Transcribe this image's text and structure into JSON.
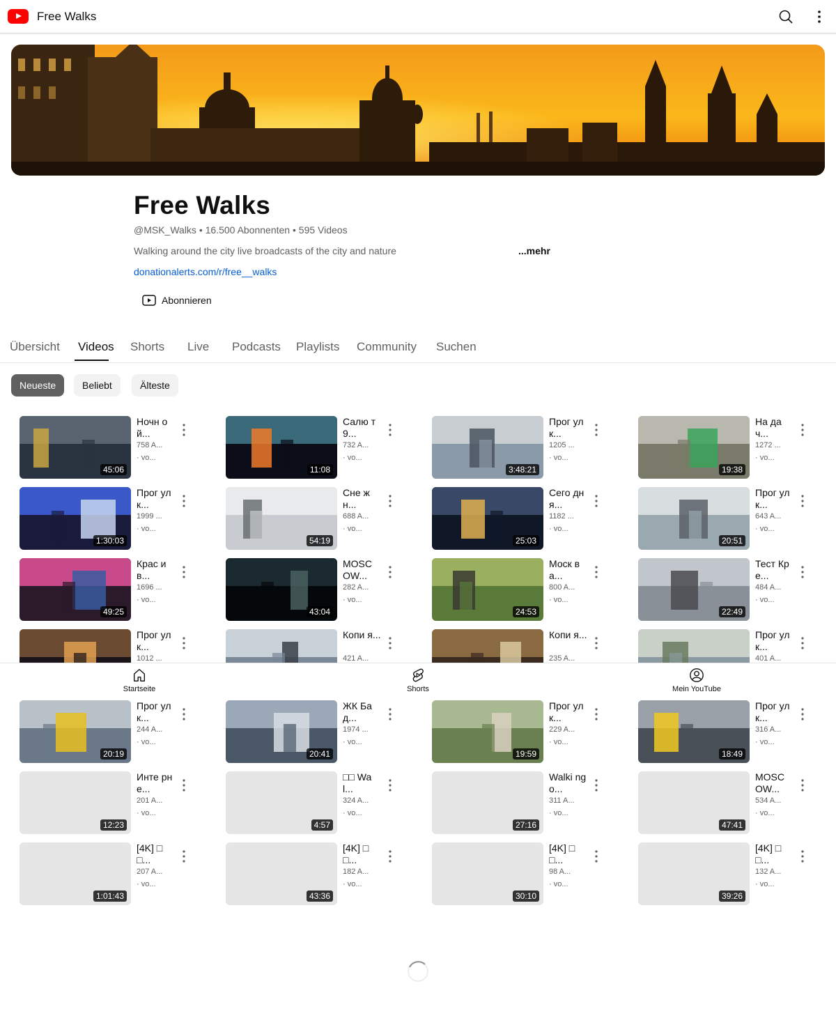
{
  "topbar": {
    "title": "Free Walks"
  },
  "channel": {
    "name": "Free Walks",
    "handle": "@MSK_Walks",
    "sep1": "•",
    "subscribers": "16.500 Abonnenten",
    "sep2": "•",
    "video_count": "595 Videos",
    "description": "Walking around the city live broadcasts of the city and nature",
    "more": "...mehr",
    "link": "donationalerts.com/r/free__walks",
    "subscribe_label": "Abonnieren"
  },
  "tabs": [
    {
      "label": "Übersicht"
    },
    {
      "label": "Videos"
    },
    {
      "label": "Shorts"
    },
    {
      "label": "Live"
    },
    {
      "label": "Podcasts"
    },
    {
      "label": "Playlists"
    },
    {
      "label": "Community"
    },
    {
      "label": "Suchen"
    }
  ],
  "chips": [
    {
      "label": "Neueste"
    },
    {
      "label": "Beliebt"
    },
    {
      "label": "Älteste"
    }
  ],
  "videos": [
    {
      "title": "Ночн ой...",
      "views": "758 A...",
      "age": "· vo...",
      "duration": "45:06"
    },
    {
      "title": "Салю т 9...",
      "views": "732 A...",
      "age": "· vo...",
      "duration": "11:08"
    },
    {
      "title": "Прог улк...",
      "views": "1205 ...",
      "age": "· vo...",
      "duration": "3:48:21"
    },
    {
      "title": "На дач...",
      "views": "1272 ...",
      "age": "· vo...",
      "duration": "19:38"
    },
    {
      "title": "Прог улк...",
      "views": "1999 ...",
      "age": "· vo...",
      "duration": "1:30:03"
    },
    {
      "title": "Сне жн...",
      "views": "688 A...",
      "age": "· vo...",
      "duration": "54:19"
    },
    {
      "title": "Сего дня...",
      "views": "1182 ...",
      "age": "· vo...",
      "duration": "25:03"
    },
    {
      "title": "Прог улк...",
      "views": "643 A...",
      "age": "· vo...",
      "duration": "20:51"
    },
    {
      "title": "Крас ив...",
      "views": "1696 ...",
      "age": "· vo...",
      "duration": "49:25"
    },
    {
      "title": "MOSC OW...",
      "views": "282 A...",
      "age": "· vo...",
      "duration": "43:04"
    },
    {
      "title": "Моск ва...",
      "views": "800 A...",
      "age": "· vo...",
      "duration": "24:53"
    },
    {
      "title": "Тест Кре...",
      "views": "484 A...",
      "age": "· vo...",
      "duration": "22:49"
    },
    {
      "title": "Прог улк...",
      "views": "1012 ...",
      "age": "",
      "duration": ""
    },
    {
      "title": "Копи я...",
      "views": "421 A...",
      "age": "",
      "duration": ""
    },
    {
      "title": "Копи я...",
      "views": "235 A...",
      "age": "",
      "duration": ""
    },
    {
      "title": "Прог улк...",
      "views": "401 A...",
      "age": "",
      "duration": ""
    },
    {
      "title": "Прог улк...",
      "views": "244 A...",
      "age": "· vo...",
      "duration": "20:19"
    },
    {
      "title": "ЖК Бад...",
      "views": "1974 ...",
      "age": "· vo...",
      "duration": "20:41"
    },
    {
      "title": "Прог улк...",
      "views": "229 A...",
      "age": "· vo...",
      "duration": "19:59"
    },
    {
      "title": "Прог улк...",
      "views": "316 A...",
      "age": "· vo...",
      "duration": "18:49"
    },
    {
      "title": "Инте рне...",
      "views": "201 A...",
      "age": "· vo...",
      "duration": "12:23"
    },
    {
      "title": "□□ Wal...",
      "views": "324 A...",
      "age": "· vo...",
      "duration": "4:57"
    },
    {
      "title": "Walki ng o...",
      "views": "311 A...",
      "age": "· vo...",
      "duration": "27:16"
    },
    {
      "title": "MOSC OW...",
      "views": "534 A...",
      "age": "· vo...",
      "duration": "47:41"
    },
    {
      "title": "[4K] □□...",
      "views": "207 A...",
      "age": "· vo...",
      "duration": "1:01:43"
    },
    {
      "title": "[4K] □□...",
      "views": "182 A...",
      "age": "· vo...",
      "duration": "43:36"
    },
    {
      "title": "[4K] □□...",
      "views": "98 A...",
      "age": "· vo...",
      "duration": "30:10"
    },
    {
      "title": "[4K] □□...",
      "views": "132 A...",
      "age": "· vo...",
      "duration": "39:26"
    }
  ],
  "bottom_nav": [
    {
      "label": "Startseite",
      "icon": "home-icon"
    },
    {
      "label": "Shorts",
      "icon": "shorts-icon"
    },
    {
      "label": "Mein YouTube",
      "icon": "account-icon"
    }
  ],
  "colors": {
    "brand": "#ff0000",
    "link": "#065fd4",
    "chip_active": "#606060",
    "secondary_text": "#606060"
  }
}
